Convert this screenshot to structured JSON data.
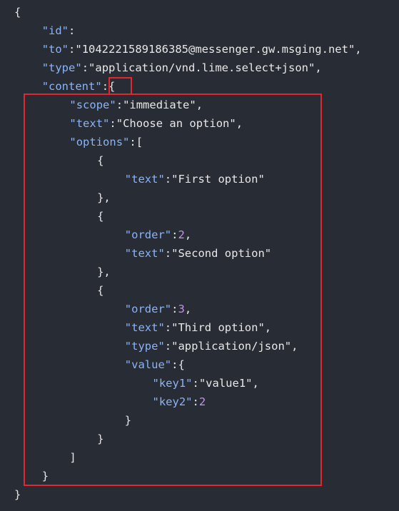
{
  "code_lines": [
    {
      "indent": 0,
      "parts": [
        {
          "t": "punc",
          "v": "{"
        }
      ]
    },
    {
      "indent": 1,
      "parts": [
        {
          "t": "key",
          "v": "\"id\""
        },
        {
          "t": "punc",
          "v": ":"
        }
      ]
    },
    {
      "indent": 1,
      "parts": [
        {
          "t": "key",
          "v": "\"to\""
        },
        {
          "t": "punc",
          "v": ":"
        },
        {
          "t": "str",
          "v": "\"1042221589186385@messenger.gw.msging.net\""
        },
        {
          "t": "punc",
          "v": ","
        }
      ]
    },
    {
      "indent": 1,
      "parts": [
        {
          "t": "key",
          "v": "\"type\""
        },
        {
          "t": "punc",
          "v": ":"
        },
        {
          "t": "str",
          "v": "\"application/vnd.lime.select+json\""
        },
        {
          "t": "punc",
          "v": ","
        }
      ]
    },
    {
      "indent": 1,
      "parts": [
        {
          "t": "key",
          "v": "\"content\""
        },
        {
          "t": "punc",
          "v": ":{"
        }
      ]
    },
    {
      "indent": 2,
      "parts": [
        {
          "t": "key",
          "v": "\"scope\""
        },
        {
          "t": "punc",
          "v": ":"
        },
        {
          "t": "str",
          "v": "\"immediate\""
        },
        {
          "t": "punc",
          "v": ","
        }
      ]
    },
    {
      "indent": 2,
      "parts": [
        {
          "t": "key",
          "v": "\"text\""
        },
        {
          "t": "punc",
          "v": ":"
        },
        {
          "t": "str",
          "v": "\"Choose an option\""
        },
        {
          "t": "punc",
          "v": ","
        }
      ]
    },
    {
      "indent": 2,
      "parts": [
        {
          "t": "key",
          "v": "\"options\""
        },
        {
          "t": "punc",
          "v": ":["
        }
      ]
    },
    {
      "indent": 3,
      "parts": [
        {
          "t": "punc",
          "v": "{"
        }
      ]
    },
    {
      "indent": 4,
      "parts": [
        {
          "t": "key",
          "v": "\"text\""
        },
        {
          "t": "punc",
          "v": ":"
        },
        {
          "t": "str",
          "v": "\"First option\""
        }
      ]
    },
    {
      "indent": 3,
      "parts": [
        {
          "t": "punc",
          "v": "},"
        }
      ]
    },
    {
      "indent": 3,
      "parts": [
        {
          "t": "punc",
          "v": "{"
        }
      ]
    },
    {
      "indent": 4,
      "parts": [
        {
          "t": "key",
          "v": "\"order\""
        },
        {
          "t": "punc",
          "v": ":"
        },
        {
          "t": "num",
          "v": "2"
        },
        {
          "t": "punc",
          "v": ","
        }
      ]
    },
    {
      "indent": 4,
      "parts": [
        {
          "t": "key",
          "v": "\"text\""
        },
        {
          "t": "punc",
          "v": ":"
        },
        {
          "t": "str",
          "v": "\"Second option\""
        }
      ]
    },
    {
      "indent": 3,
      "parts": [
        {
          "t": "punc",
          "v": "},"
        }
      ]
    },
    {
      "indent": 3,
      "parts": [
        {
          "t": "punc",
          "v": "{"
        }
      ]
    },
    {
      "indent": 4,
      "parts": [
        {
          "t": "key",
          "v": "\"order\""
        },
        {
          "t": "punc",
          "v": ":"
        },
        {
          "t": "num",
          "v": "3"
        },
        {
          "t": "punc",
          "v": ","
        }
      ]
    },
    {
      "indent": 4,
      "parts": [
        {
          "t": "key",
          "v": "\"text\""
        },
        {
          "t": "punc",
          "v": ":"
        },
        {
          "t": "str",
          "v": "\"Third option\""
        },
        {
          "t": "punc",
          "v": ","
        }
      ]
    },
    {
      "indent": 4,
      "parts": [
        {
          "t": "key",
          "v": "\"type\""
        },
        {
          "t": "punc",
          "v": ":"
        },
        {
          "t": "str",
          "v": "\"application/json\""
        },
        {
          "t": "punc",
          "v": ","
        }
      ]
    },
    {
      "indent": 4,
      "parts": [
        {
          "t": "key",
          "v": "\"value\""
        },
        {
          "t": "punc",
          "v": ":{"
        }
      ]
    },
    {
      "indent": 5,
      "parts": [
        {
          "t": "key",
          "v": "\"key1\""
        },
        {
          "t": "punc",
          "v": ":"
        },
        {
          "t": "str",
          "v": "\"value1\""
        },
        {
          "t": "punc",
          "v": ","
        }
      ]
    },
    {
      "indent": 5,
      "parts": [
        {
          "t": "key",
          "v": "\"key2\""
        },
        {
          "t": "punc",
          "v": ":"
        },
        {
          "t": "num",
          "v": "2"
        }
      ]
    },
    {
      "indent": 4,
      "parts": [
        {
          "t": "punc",
          "v": "}"
        }
      ]
    },
    {
      "indent": 3,
      "parts": [
        {
          "t": "punc",
          "v": "}"
        }
      ]
    },
    {
      "indent": 2,
      "parts": [
        {
          "t": "punc",
          "v": "]"
        }
      ]
    },
    {
      "indent": 1,
      "parts": [
        {
          "t": "punc",
          "v": "}"
        }
      ]
    },
    {
      "indent": 0,
      "parts": [
        {
          "t": "punc",
          "v": "}"
        }
      ]
    }
  ],
  "colors": {
    "background": "#282c34",
    "key": "#8ab4f8",
    "string": "#e8e8e8",
    "number": "#c792ea",
    "highlight": "#e5262f"
  }
}
